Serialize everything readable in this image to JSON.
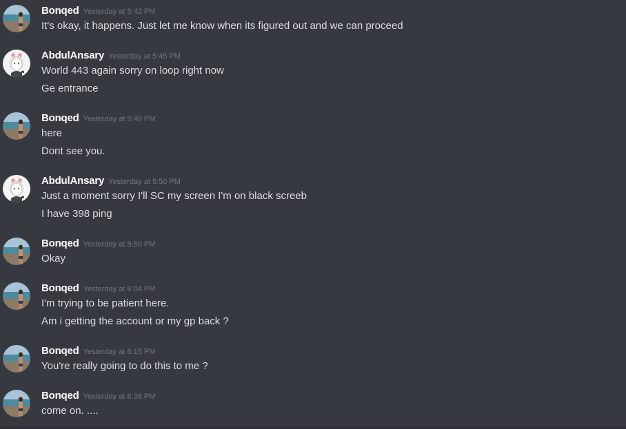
{
  "colors": {
    "background": "#36393f",
    "username": "#ffffff",
    "timestamp": "#72767d",
    "message_text": "#dcddde"
  },
  "messages": [
    {
      "author": "Bonqed",
      "avatar": "beach-photo-avatar",
      "timestamp": "Yesterday at 5:42 PM",
      "lines": [
        "It's okay, it happens. Just let me know when its figured out and we can proceed"
      ]
    },
    {
      "author": "AbdulAnsary",
      "avatar": "cartoon-girl-avatar",
      "timestamp": "Yesterday at 5:45 PM",
      "lines": [
        "World 443 again sorry on loop right now",
        "Ge entrance"
      ]
    },
    {
      "author": "Bonqed",
      "avatar": "beach-photo-avatar",
      "timestamp": "Yesterday at 5:46 PM",
      "lines": [
        "here",
        "Dont see you."
      ]
    },
    {
      "author": "AbdulAnsary",
      "avatar": "cartoon-girl-avatar",
      "timestamp": "Yesterday at 5:50 PM",
      "lines": [
        "Just a moment sorry I'll SC my screen I'm on black screeb",
        "I have 398 ping"
      ]
    },
    {
      "author": "Bonqed",
      "avatar": "beach-photo-avatar",
      "timestamp": "Yesterday at 5:50 PM",
      "lines": [
        "Okay"
      ]
    },
    {
      "author": "Bonqed",
      "avatar": "beach-photo-avatar",
      "timestamp": "Yesterday at 6:04 PM",
      "lines": [
        "I'm trying to be patient here.",
        "Am i getting the account or my gp back ?"
      ]
    },
    {
      "author": "Bonqed",
      "avatar": "beach-photo-avatar",
      "timestamp": "Yesterday at 6:15 PM",
      "lines": [
        "You're really going to do this to me ?"
      ]
    },
    {
      "author": "Bonqed",
      "avatar": "beach-photo-avatar",
      "timestamp": "Yesterday at 6:38 PM",
      "lines": [
        "come on. ...."
      ]
    }
  ]
}
